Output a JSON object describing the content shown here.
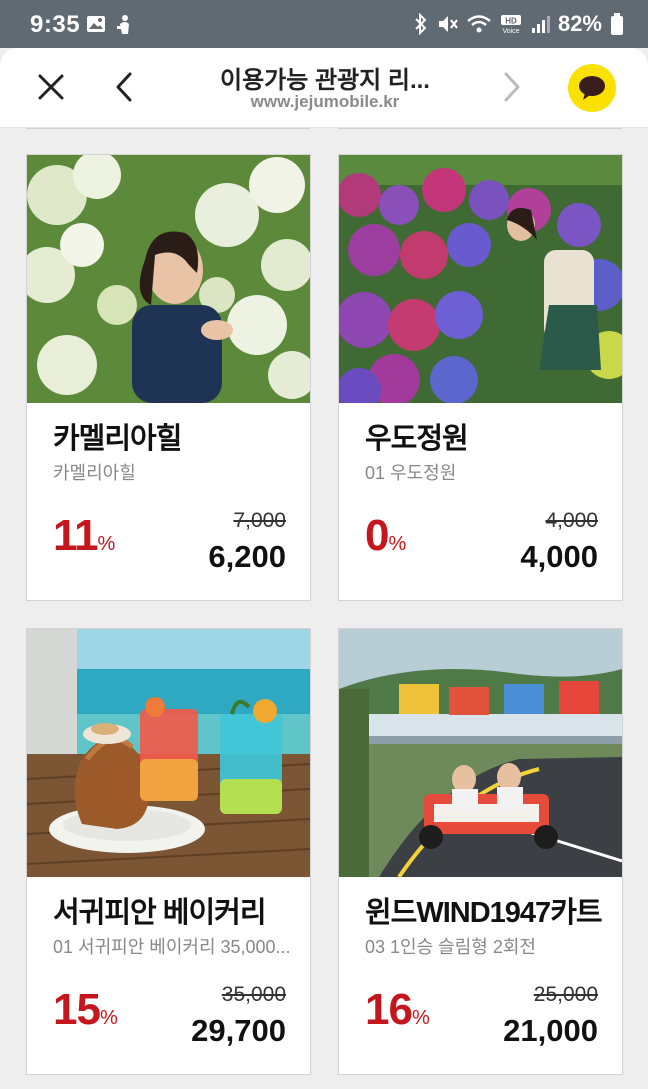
{
  "status_bar": {
    "time": "9:35",
    "battery": "82%"
  },
  "browser": {
    "title": "이용가능 관광지 리...",
    "url": "www.jejumobile.kr"
  },
  "products": [
    {
      "name": "카멜리아힐",
      "subtitle": "카멜리아힐",
      "discount": "11",
      "percent": "%",
      "original_price": "7,000",
      "price": "6,200"
    },
    {
      "name": "우도정원",
      "subtitle": "01 우도정원",
      "discount": "0",
      "percent": "%",
      "original_price": "4,000",
      "price": "4,000"
    },
    {
      "name": "서귀피안 베이커리",
      "subtitle": "01 서귀피안 베이커리 35,000...",
      "discount": "15",
      "percent": "%",
      "original_price": "35,000",
      "price": "29,700"
    },
    {
      "name": "윈드WIND1947카트",
      "subtitle": "03 1인승 슬림형 2회전",
      "discount": "16",
      "percent": "%",
      "original_price": "25,000",
      "price": "21,000"
    }
  ],
  "colors": {
    "discount": "#c4161c",
    "kakao": "#fae100",
    "status_bar": "#5f6a72"
  }
}
